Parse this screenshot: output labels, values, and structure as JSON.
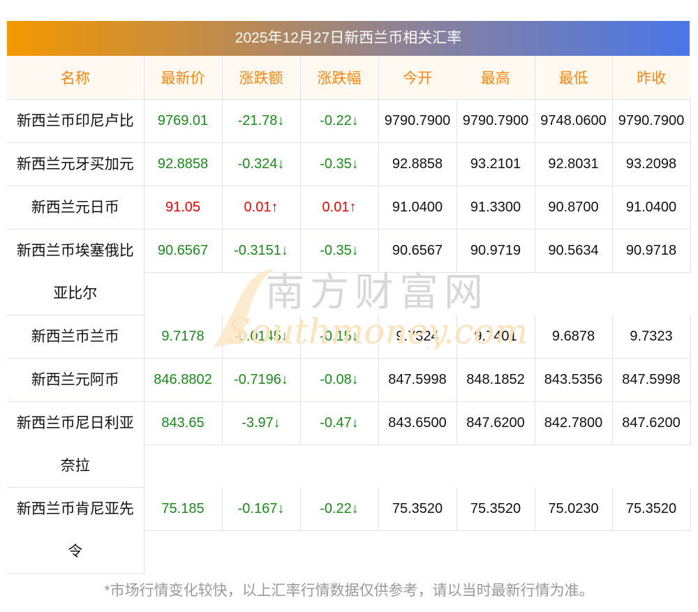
{
  "title": "2025年12月27日新西兰币相关汇率",
  "headers": [
    "名称",
    "最新价",
    "涨跌额",
    "涨跌幅",
    "今开",
    "最高",
    "最低",
    "昨收"
  ],
  "rows": [
    {
      "name": "新西兰币印尼卢比",
      "price": "9769.01",
      "change": "-21.78↓",
      "pct": "-0.22↓",
      "open": "9790.7900",
      "high": "9790.7900",
      "low": "9748.0600",
      "prev": "9790.7900",
      "dir": "down",
      "two": false
    },
    {
      "name": "新西兰元牙买加元",
      "price": "92.8858",
      "change": "-0.324↓",
      "pct": "-0.35↓",
      "open": "92.8858",
      "high": "93.2101",
      "low": "92.8031",
      "prev": "93.2098",
      "dir": "down",
      "two": false
    },
    {
      "name": "新西兰元日币",
      "price": "91.05",
      "change": "0.01↑",
      "pct": "0.01↑",
      "open": "91.0400",
      "high": "91.3300",
      "low": "90.8700",
      "prev": "91.0400",
      "dir": "up",
      "two": false
    },
    {
      "name": "新西兰币埃塞俄比亚比尔",
      "price": "90.6567",
      "change": "-0.3151↓",
      "pct": "-0.35↓",
      "open": "90.6567",
      "high": "90.9719",
      "low": "90.5634",
      "prev": "90.9718",
      "dir": "down",
      "two": true
    },
    {
      "name": "新西兰币兰币",
      "price": "9.7178",
      "change": "-0.0145↓",
      "pct": "-0.15↓",
      "open": "9.7324",
      "high": "9.7401",
      "low": "9.6878",
      "prev": "9.7323",
      "dir": "down",
      "two": false
    },
    {
      "name": "新西兰元阿币",
      "price": "846.8802",
      "change": "-0.7196↓",
      "pct": "-0.08↓",
      "open": "847.5998",
      "high": "848.1852",
      "low": "843.5356",
      "prev": "847.5998",
      "dir": "down",
      "two": false
    },
    {
      "name": "新西兰币尼日利亚奈拉",
      "price": "843.65",
      "change": "-3.97↓",
      "pct": "-0.47↓",
      "open": "843.6500",
      "high": "847.6200",
      "low": "842.7800",
      "prev": "847.6200",
      "dir": "down",
      "two": true
    },
    {
      "name": "新西兰币肯尼亚先令",
      "price": "75.185",
      "change": "-0.167↓",
      "pct": "-0.22↓",
      "open": "75.3520",
      "high": "75.3520",
      "low": "75.0230",
      "prev": "75.3520",
      "dir": "down",
      "two": true
    }
  ],
  "watermark": {
    "cn": "南方财富网",
    "en": "Southmoney.com"
  },
  "footer": "*市场行情变化较快，以上汇率行情数据仅供参考，请以当时最新行情为准。",
  "colors": {
    "up": "#f40000",
    "down": "#1a8a1a",
    "header": "#f7870d"
  }
}
